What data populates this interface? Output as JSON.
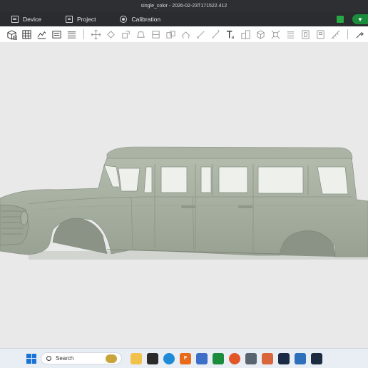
{
  "window": {
    "title": "single_color - 2026-02-23T171522.412"
  },
  "menu": {
    "device": "Device",
    "project": "Project",
    "calibration": "Calibration"
  },
  "toolbar": {
    "icons": [
      "add-object",
      "arrange-grid",
      "import",
      "plate",
      "list",
      "move",
      "rotate",
      "scale",
      "cut",
      "seam",
      "support",
      "paint",
      "text",
      "split",
      "assembly",
      "measure",
      "variable-layer",
      "part-a",
      "part-b",
      "fix-model"
    ]
  },
  "taskbar": {
    "search_placeholder": "Search",
    "apps": [
      "explorer",
      "terminal",
      "edge",
      "fusion",
      "store",
      "bambu-studio",
      "firefox",
      "calculator",
      "blender",
      "app-a",
      "app-b",
      "app-c"
    ]
  },
  "colors": {
    "titlebar": "#2d2f33",
    "menubar": "#2a2c30",
    "viewport": "#e9e9e9",
    "model": "#a4ad9f",
    "accent": "#1a8c3c"
  }
}
